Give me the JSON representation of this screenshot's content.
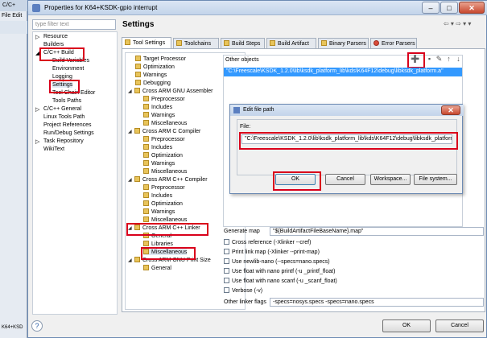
{
  "background_window": {
    "title": "C/C+",
    "menu": "File  Edit",
    "bottom": "K64+KSD"
  },
  "dialog": {
    "title": "Properties for K64+KSDK-gpio interrupt",
    "min": "–",
    "max": "□",
    "close": "✕"
  },
  "nav": {
    "filter_placeholder": "type filter text",
    "items": [
      "Resource",
      "Builders",
      "C/C++ Build",
      "Build Variables",
      "Environment",
      "Logging",
      "Settings",
      "Tool Chain Editor",
      "Tools Paths",
      "C/C++ General",
      "Linux Tools Path",
      "Project References",
      "Run/Debug Settings",
      "Task Repository",
      "WikiText"
    ]
  },
  "header": {
    "title": "Settings",
    "nav_icons": "⇦ ▾ ⇨ ▾ ▾"
  },
  "tabs": [
    "Tool Settings",
    "Toolchains",
    "Build Steps",
    "Build Artifact",
    "Binary Parsers",
    "Error Parsers"
  ],
  "tool_tree": [
    "Target Processor",
    "Optimization",
    "Warnings",
    "Debugging",
    "Cross ARM GNU Assembler",
    "Preprocessor",
    "Includes",
    "Warnings",
    "Miscellaneous",
    "Cross ARM C Compiler",
    "Preprocessor",
    "Includes",
    "Optimization",
    "Warnings",
    "Miscellaneous",
    "Cross ARM C++ Compiler",
    "Preprocessor",
    "Includes",
    "Optimization",
    "Warnings",
    "Miscellaneous",
    "Cross ARM C++ Linker",
    "General",
    "Libraries",
    "Miscellaneous",
    "Cross ARM GNU Print Size",
    "General"
  ],
  "other_objects": {
    "title": "Other objects",
    "value": "\"C:\\Freescale\\KSDK_1.2.0\\lib\\ksdk_platform_lib\\kds\\K64F12\\debug\\libksdk_platform.a\""
  },
  "edit_path": {
    "title": "Edit file path",
    "label": "File:",
    "value": "\"C:\\Freescale\\KSDK_1.2.0\\lib\\ksdk_platform_lib\\kds\\K64F12\\debug\\libksdk_platform.a\"",
    "ok": "OK",
    "cancel": "Cancel",
    "workspace": "Workspace...",
    "filesystem": "File system..."
  },
  "options": {
    "generate_map_label": "Generate map",
    "generate_map_value": "\"${BuildArtifactFileBaseName}.map\"",
    "checkboxes": [
      "Cross reference (-Xlinker --cref)",
      "Print link map (-Xlinker --print-map)",
      "Use newlib-nano (--specs=nano.specs)",
      "Use float with nano printf (-u _printf_float)",
      "Use float with nano scanf (-u _scanf_float)",
      "Verbose (-v)"
    ],
    "other_flags_label": "Other linker flags",
    "other_flags_value": "-specs=nosys.specs -specs=nano.specs"
  },
  "footer": {
    "ok": "OK",
    "cancel": "Cancel",
    "help": "?"
  }
}
